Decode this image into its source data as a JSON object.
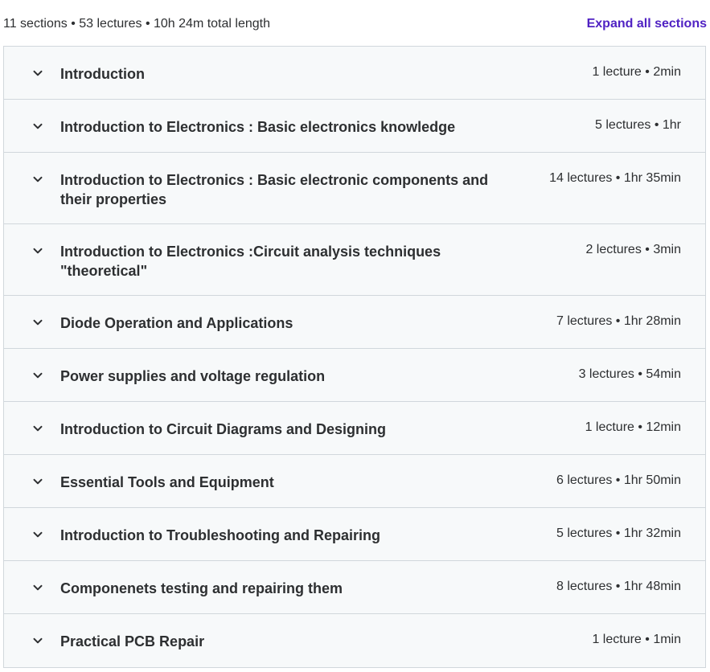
{
  "summary": {
    "text": "11 sections • 53 lectures • 10h 24m total length",
    "expand_label": "Expand all sections"
  },
  "sections": [
    {
      "title": "Introduction",
      "meta": "1 lecture • 2min"
    },
    {
      "title": "Introduction to Electronics : Basic electronics knowledge",
      "meta": "5 lectures • 1hr"
    },
    {
      "title": "Introduction to Electronics : Basic electronic components and their properties",
      "meta": "14 lectures • 1hr 35min"
    },
    {
      "title": "Introduction to Electronics :Circuit analysis techniques \"theoretical\"",
      "meta": "2 lectures • 3min"
    },
    {
      "title": "Diode Operation and Applications",
      "meta": "7 lectures • 1hr 28min"
    },
    {
      "title": "Power supplies and voltage regulation",
      "meta": "3 lectures • 54min"
    },
    {
      "title": "Introduction to Circuit Diagrams and Designing",
      "meta": "1 lecture • 12min"
    },
    {
      "title": "Essential Tools and Equipment",
      "meta": "6 lectures • 1hr 50min"
    },
    {
      "title": "Introduction to Troubleshooting and Repairing",
      "meta": "5 lectures • 1hr 32min"
    },
    {
      "title": "Componenets testing and repairing them",
      "meta": "8 lectures • 1hr 48min"
    },
    {
      "title": "Practical PCB Repair",
      "meta": "1 lecture • 1min"
    }
  ],
  "icons": {
    "section_toggle": "chevron-down-icon"
  },
  "colors": {
    "accent": "#5022c3",
    "text": "#2d2f31",
    "section_bg": "#f7f9fa",
    "border": "#d1d7dc"
  }
}
